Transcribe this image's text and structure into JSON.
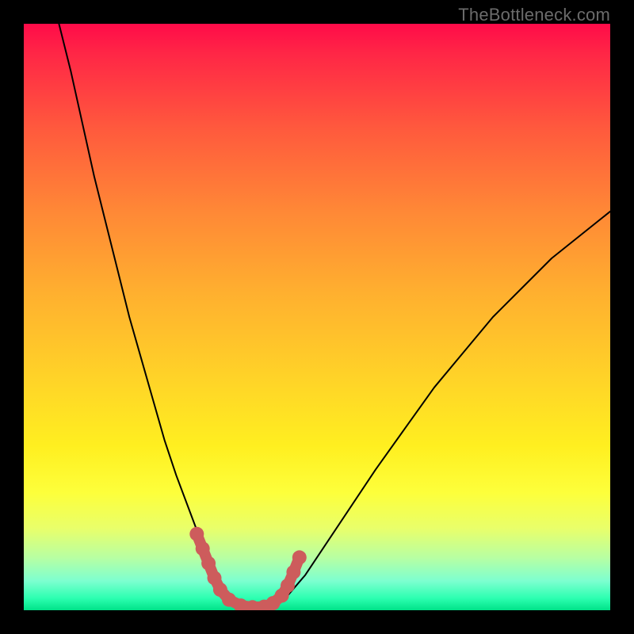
{
  "watermark": {
    "text": "TheBottleneck.com"
  },
  "chart_data": {
    "type": "line",
    "title": "",
    "xlabel": "",
    "ylabel": "",
    "xlim": [
      0,
      100
    ],
    "ylim": [
      0,
      100
    ],
    "grid": false,
    "legend": false,
    "background_gradient": {
      "stops": [
        {
          "pos": 0,
          "color": "#ff0b49"
        },
        {
          "pos": 100,
          "color": "#00e288"
        }
      ]
    },
    "series": [
      {
        "name": "bottleneck-curve",
        "x": [
          6,
          8,
          10,
          12,
          14,
          16,
          18,
          20,
          22,
          24,
          26,
          27.5,
          29,
          30.5,
          32,
          33.5,
          35,
          37,
          39,
          41,
          43,
          45,
          48,
          52,
          56,
          60,
          65,
          70,
          75,
          80,
          85,
          90,
          95,
          100
        ],
        "y": [
          100,
          92,
          83,
          74,
          66,
          58,
          50,
          43,
          36,
          29,
          23,
          19,
          15,
          11,
          7.5,
          4.5,
          2.5,
          1,
          0.5,
          0.5,
          1,
          2.5,
          6,
          12,
          18,
          24,
          31,
          38,
          44,
          50,
          55,
          60,
          64,
          68
        ]
      }
    ],
    "annotations": {
      "bead_points": [
        {
          "x": 29.5,
          "y": 13
        },
        {
          "x": 30.5,
          "y": 10.5
        },
        {
          "x": 31.5,
          "y": 8
        },
        {
          "x": 32.5,
          "y": 5.5
        },
        {
          "x": 33.5,
          "y": 3.5
        },
        {
          "x": 35,
          "y": 1.8
        },
        {
          "x": 37,
          "y": 0.8
        },
        {
          "x": 39,
          "y": 0.5
        },
        {
          "x": 41,
          "y": 0.6
        },
        {
          "x": 42.5,
          "y": 1.2
        },
        {
          "x": 44,
          "y": 2.5
        },
        {
          "x": 45,
          "y": 4.2
        },
        {
          "x": 46,
          "y": 6.5
        },
        {
          "x": 47,
          "y": 9
        }
      ],
      "bead_color": "#cd5c5c"
    }
  }
}
